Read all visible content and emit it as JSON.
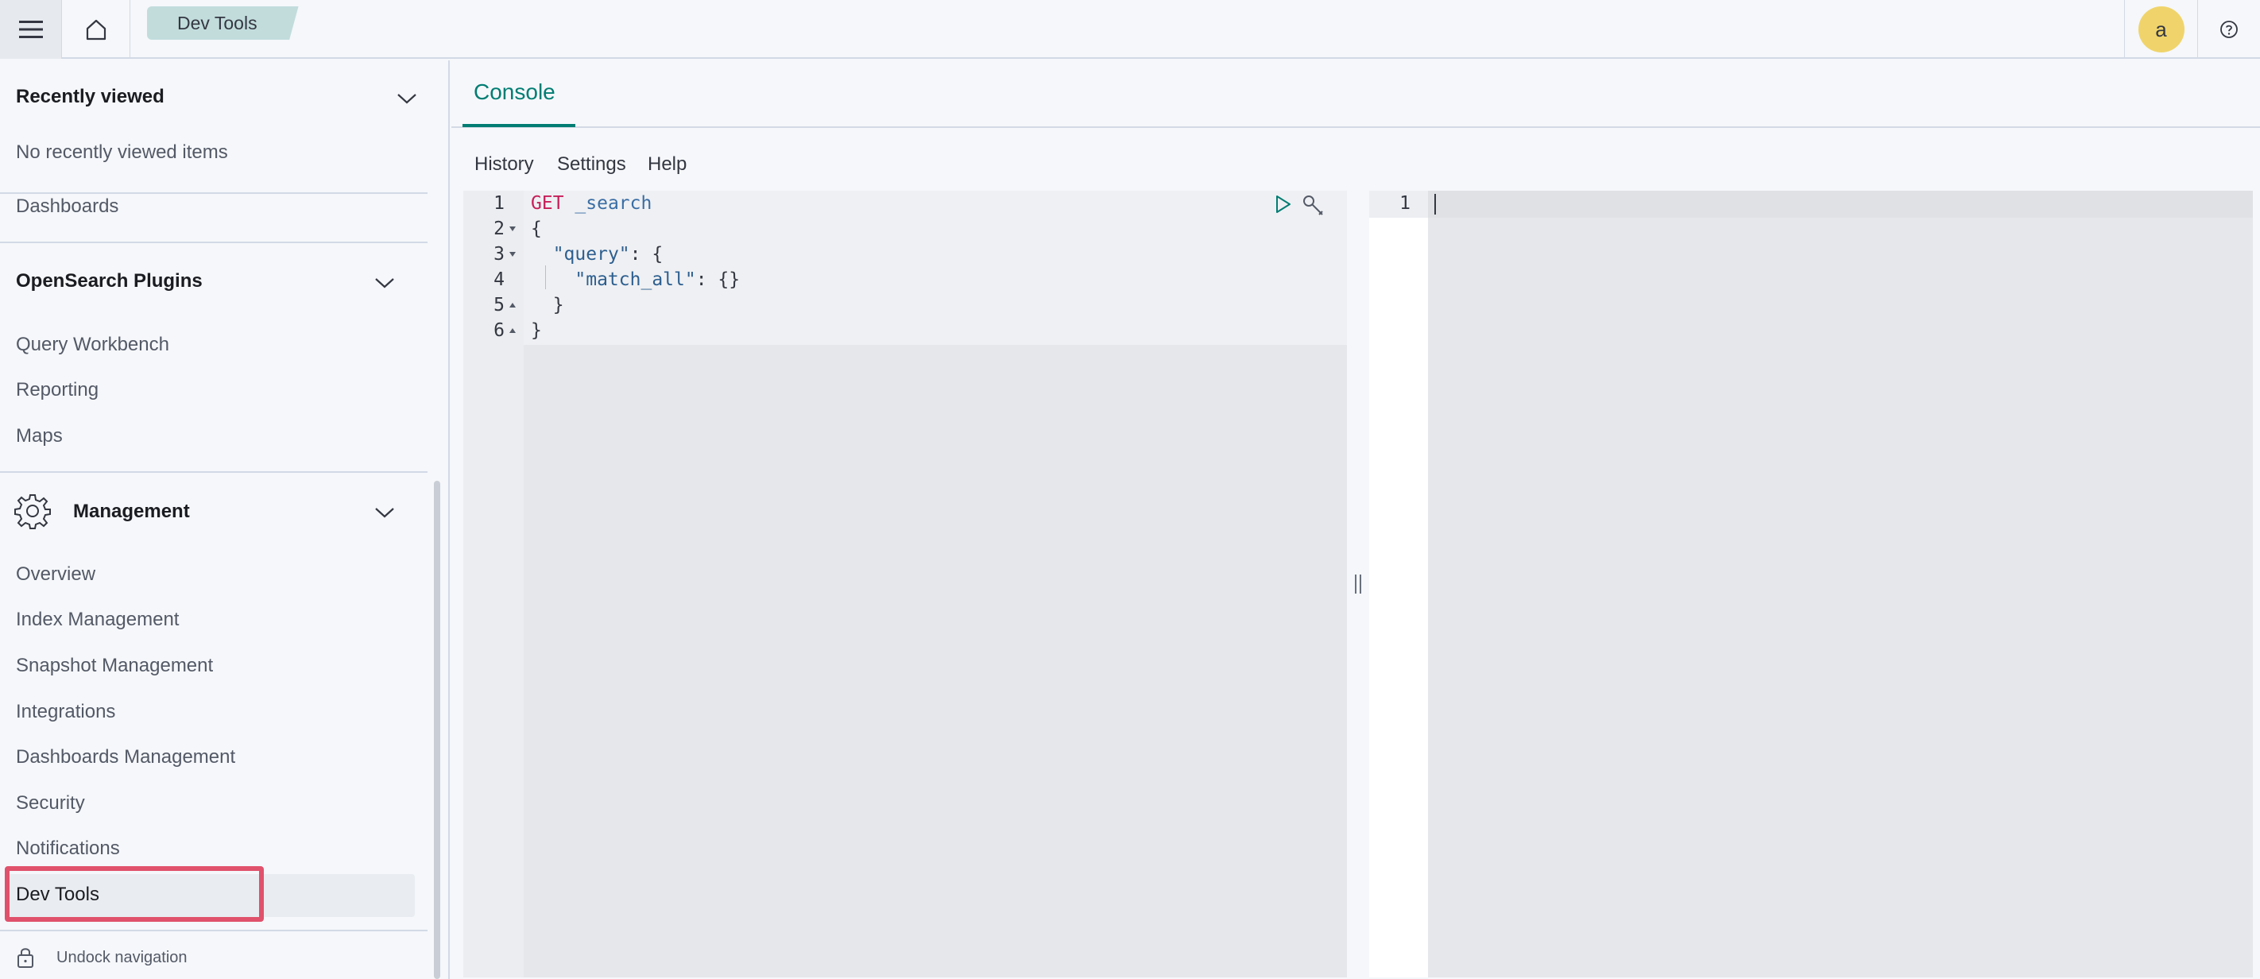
{
  "header": {
    "breadcrumb": "Dev Tools",
    "avatar_initial": "a",
    "icons": [
      "menu-icon",
      "home-icon",
      "help-icon"
    ]
  },
  "sidebar": {
    "recently_viewed": {
      "title": "Recently viewed",
      "empty_text": "No recently viewed items"
    },
    "dashboards_item": "Dashboards",
    "plugins": {
      "title": "OpenSearch Plugins",
      "items": [
        "Query Workbench",
        "Reporting",
        "Maps"
      ]
    },
    "management": {
      "title": "Management",
      "items": [
        "Overview",
        "Index Management",
        "Snapshot Management",
        "Integrations",
        "Dashboards Management",
        "Security",
        "Notifications",
        "Dev Tools"
      ]
    },
    "undock": "Undock navigation"
  },
  "console": {
    "tab": "Console",
    "menu": {
      "history": "History",
      "settings": "Settings",
      "help": "Help"
    },
    "editor": {
      "line_numbers": [
        "1",
        "2",
        "3",
        "4",
        "5",
        "6"
      ],
      "method": "GET",
      "path": "_search",
      "lines": [
        "{",
        "\"query\"",
        ": {",
        "\"match_all\"",
        ": {}",
        "}",
        "}"
      ]
    },
    "output": {
      "line_numbers": [
        "1"
      ]
    }
  },
  "colors": {
    "accent": "#017d73",
    "highlight": "#e0516b",
    "avatar": "#f0d46b",
    "crumb": "#c2dcdc"
  }
}
